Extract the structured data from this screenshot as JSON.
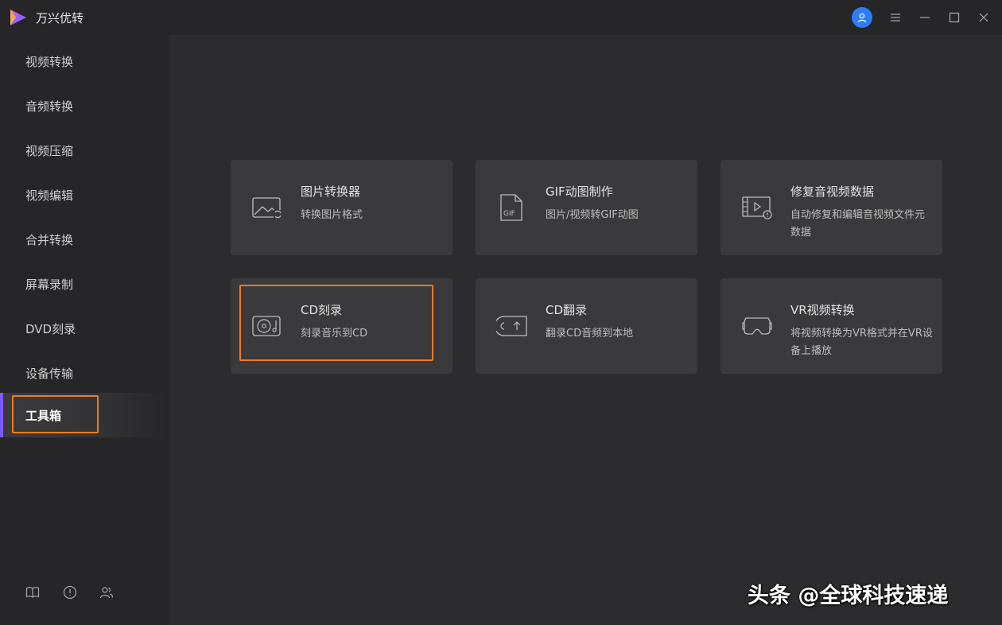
{
  "app": {
    "title": "万兴优转"
  },
  "window_controls": [
    "user-icon",
    "menu-icon",
    "minimize-icon",
    "maximize-icon",
    "close-icon"
  ],
  "sidebar": {
    "items": [
      {
        "label": "视频转换"
      },
      {
        "label": "音频转换"
      },
      {
        "label": "视频压缩"
      },
      {
        "label": "视频编辑"
      },
      {
        "label": "合并转换"
      },
      {
        "label": "屏幕录制"
      },
      {
        "label": "DVD刻录"
      },
      {
        "label": "设备传输"
      },
      {
        "label": "工具箱",
        "active": true
      }
    ],
    "bottom_icons": [
      "book-icon",
      "info-icon",
      "users-icon"
    ]
  },
  "tools": [
    {
      "title": "图片转换器",
      "desc": "转换图片格式",
      "icon": "image-convert-icon"
    },
    {
      "title": "GIF动图制作",
      "desc": "图片/视频转GIF动图",
      "icon": "gif-file-icon"
    },
    {
      "title": "修复音视频数据",
      "desc": "自动修复和编辑音视频文件元数据",
      "icon": "media-metadata-icon"
    },
    {
      "title": "CD刻录",
      "desc": "刻录音乐到CD",
      "icon": "cd-burn-icon",
      "highlighted": true
    },
    {
      "title": "CD翻录",
      "desc": "翻录CD音频到本地",
      "icon": "cd-rip-icon"
    },
    {
      "title": "VR视频转换",
      "desc": "将视频转换为VR格式并在VR设备上播放",
      "icon": "vr-headset-icon"
    }
  ],
  "watermark": "头条 @全球科技速递",
  "colors": {
    "accent": "#7b5cff",
    "highlight_box": "#f07a1e",
    "avatar": "#2e7cf6",
    "card_bg": "#3a3a3c",
    "sidebar_bg": "#262628"
  }
}
